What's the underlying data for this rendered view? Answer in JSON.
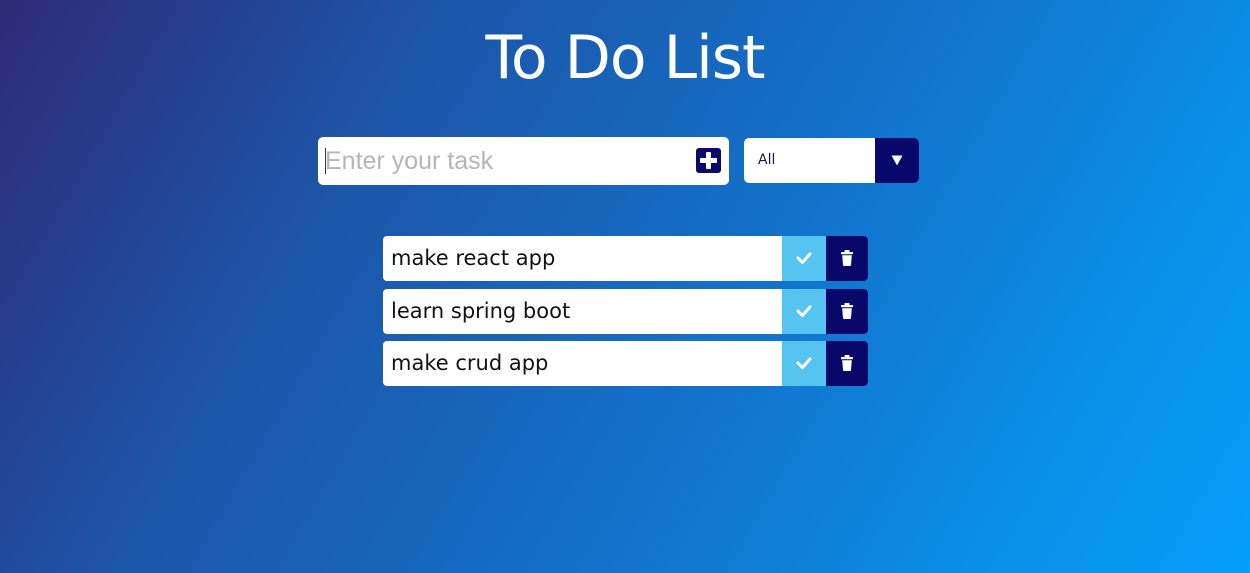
{
  "header": {
    "title": "To Do List"
  },
  "form": {
    "input_placeholder": "Enter your task",
    "input_value": "",
    "add_icon": "plus-square-icon"
  },
  "filter": {
    "selected": "All",
    "arrow_icon": "caret-down-icon"
  },
  "todos": [
    {
      "text": "make react app",
      "complete_icon": "check-icon",
      "delete_icon": "trash-icon"
    },
    {
      "text": "learn spring boot",
      "complete_icon": "check-icon",
      "delete_icon": "trash-icon"
    },
    {
      "text": "make crud app",
      "complete_icon": "check-icon",
      "delete_icon": "trash-icon"
    }
  ],
  "colors": {
    "accent_dark": "#08086a",
    "complete_light": "#55c4f0",
    "background_start": "#2e2a78",
    "background_end": "#049ffa"
  }
}
